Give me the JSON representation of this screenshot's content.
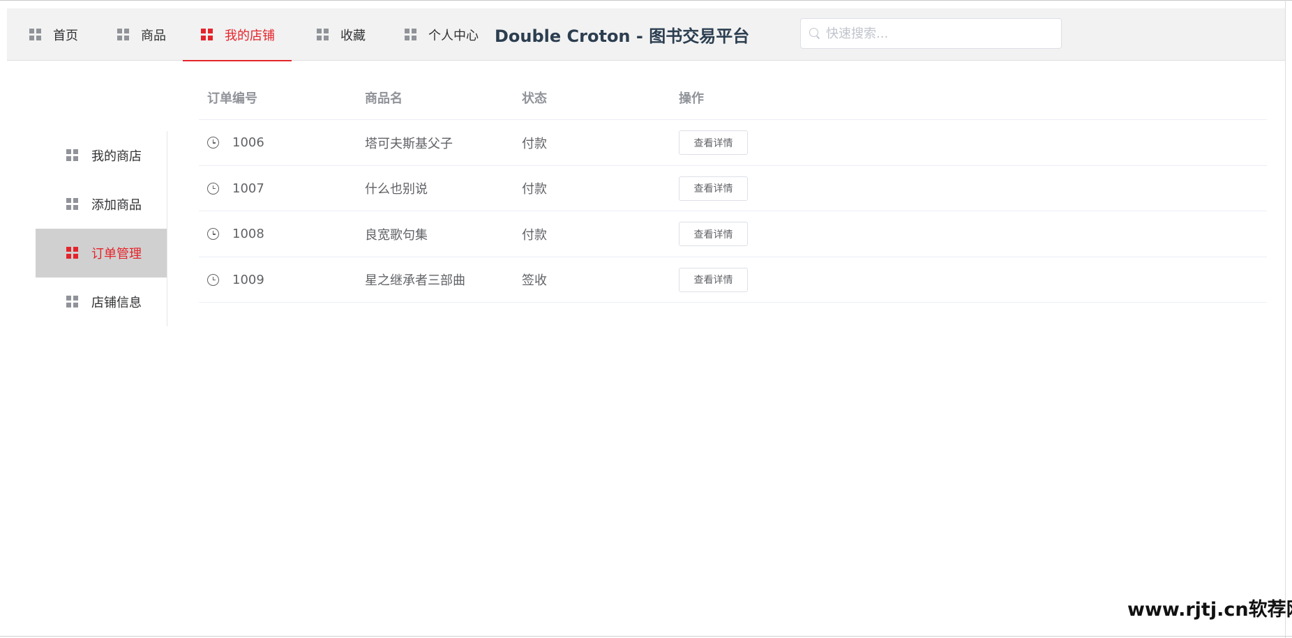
{
  "header": {
    "nav": [
      {
        "label": "首页",
        "icon": "grid-icon",
        "active": false
      },
      {
        "label": "商品",
        "icon": "grid-icon",
        "active": false
      },
      {
        "label": "我的店铺",
        "icon": "grid-icon",
        "active": true
      },
      {
        "label": "收藏",
        "icon": "grid-icon",
        "active": false
      },
      {
        "label": "个人中心",
        "icon": "grid-icon",
        "active": false
      }
    ],
    "title": "Double Croton - 图书交易平台",
    "search": {
      "placeholder": "快速搜索...",
      "value": ""
    }
  },
  "sidebar": {
    "items": [
      {
        "label": "我的商店",
        "icon": "grid-icon",
        "active": false
      },
      {
        "label": "添加商品",
        "icon": "grid-icon",
        "active": false
      },
      {
        "label": "订单管理",
        "icon": "grid-icon",
        "active": true
      },
      {
        "label": "店铺信息",
        "icon": "grid-icon",
        "active": false
      }
    ]
  },
  "orders": {
    "columns": [
      "订单编号",
      "商品名",
      "状态",
      "操作"
    ],
    "rows": [
      {
        "id": "1006",
        "name": "塔可夫斯基父子",
        "status": "付款",
        "action": "查看详情"
      },
      {
        "id": "1007",
        "name": "什么也别说",
        "status": "付款",
        "action": "查看详情"
      },
      {
        "id": "1008",
        "name": "良宽歌句集",
        "status": "付款",
        "action": "查看详情"
      },
      {
        "id": "1009",
        "name": "星之继承者三部曲",
        "status": "签收",
        "action": "查看详情"
      }
    ]
  },
  "watermark": "www.rjtj.cn软荐网",
  "colors": {
    "accent": "#e4242b",
    "header_bg": "#f2f2f2",
    "active_side_bg": "#d0d0d0"
  }
}
